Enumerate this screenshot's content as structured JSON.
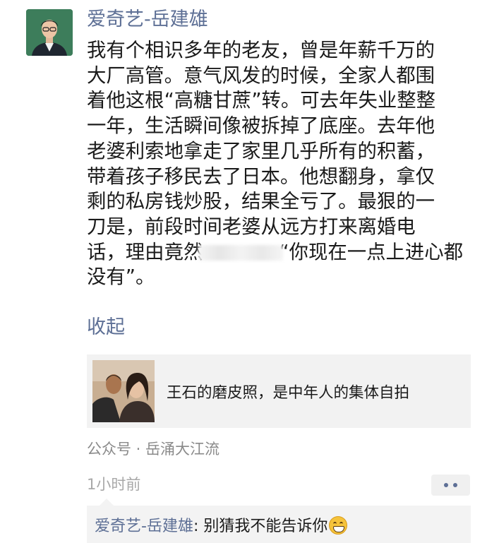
{
  "post": {
    "author": "爱奇艺-岳建雄",
    "lines": [
      "我有个相识多年的老友，曾是年薪千万的",
      "大厂高管。意气风发的时候，全家人都围",
      "着他这根“高糖甘蔗”转。可去年失业整整",
      "一年，生活瞬间像被拆掉了底座。去年他",
      "老婆利索地拿走了家里几乎所有的积蓄，",
      "带着孩子移民去了日本。他想翻身，拿仅",
      "剩的私房钱炒股，结果全亏了。最狠的一",
      "刀是，前段时间老婆从远方打来离婚电"
    ],
    "line9_start": "话，理由竟然",
    "line9_end": "“你现在一点上进心都",
    "line10": "没有”。",
    "collapse_label": "收起"
  },
  "shared_article": {
    "title": "王石的磨皮照，是中年人的集体自拍"
  },
  "source": "公众号 · 岳涌大江流",
  "time": "1小时前",
  "comment": {
    "author": "爱奇艺-岳建雄",
    "separator": ": ",
    "text": "别猜我不能告诉你"
  },
  "colors": {
    "link_blue": "#5d6f95",
    "card_bg": "#f2f2f2"
  }
}
